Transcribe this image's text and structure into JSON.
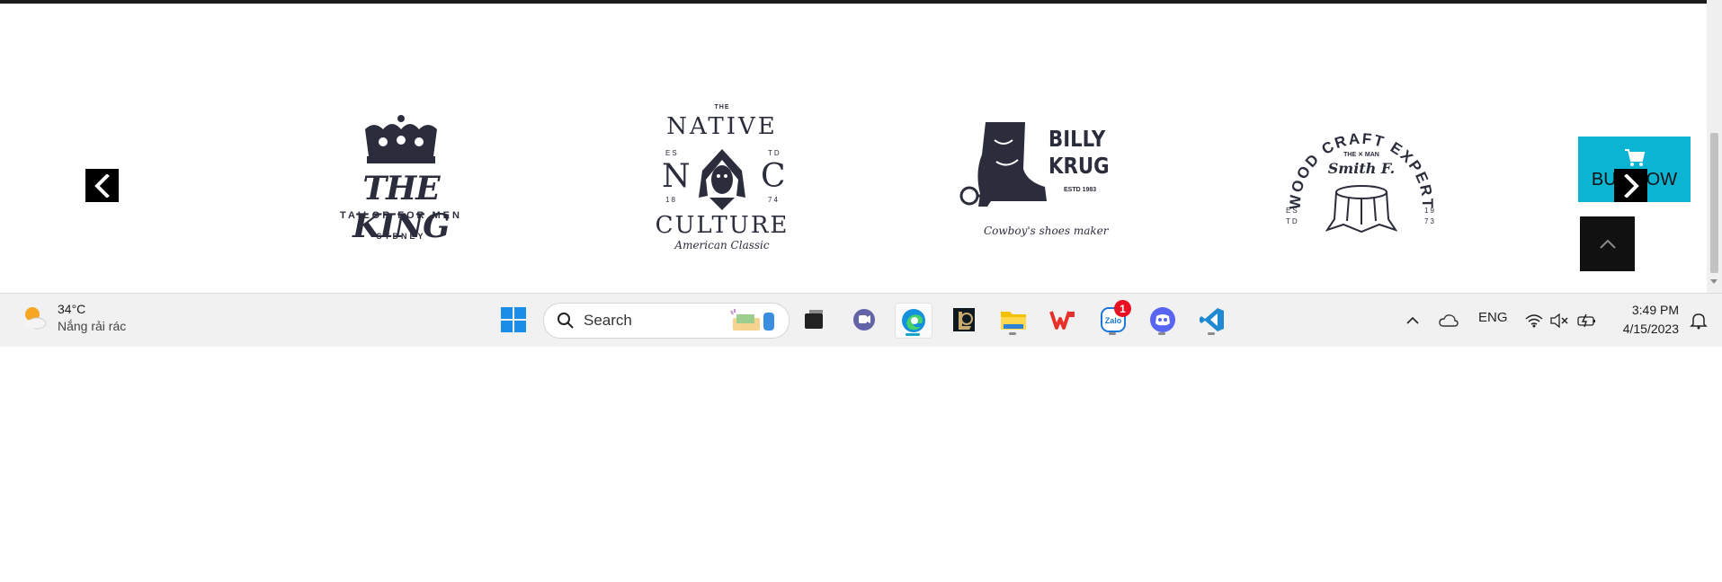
{
  "page": {
    "brands": [
      {
        "name": "THE KING",
        "tagline": "TAILOR FOR MEN",
        "city": "SYDNEY"
      },
      {
        "top": "THE",
        "name_line1": "NATIVE",
        "left_letter": "N",
        "right_letter": "C",
        "name_line2": "CULTURE",
        "script": "American Classic",
        "est_left": "ES",
        "est_right": "TD",
        "year_left": "18",
        "year_right": "74"
      },
      {
        "name_line1": "BILLY",
        "name_line2": "KRUG",
        "estd": "ESTD 1983",
        "script": "Cowboy's shoes maker"
      },
      {
        "arc": "WOOD CRAFT EXPERT",
        "small": "THE ✕ MAN",
        "script": "Smith F.",
        "est_left": "ES",
        "est_left2": "TD",
        "year_left": "19",
        "year_right": "73"
      }
    ],
    "buy_now_label": "BUY NOW",
    "prev_icon": "chevron-left-icon",
    "next_icon": "chevron-right-icon"
  },
  "taskbar": {
    "weather": {
      "temp": "34°C",
      "desc": "Nắng rải rác"
    },
    "search_placeholder": "Search",
    "zalo_badge": "1",
    "zalo_label": "Zalo",
    "lang": "ENG",
    "time": "3:49 PM",
    "date": "4/15/2023"
  },
  "colors": {
    "accent": "#0ab4d2",
    "logo_ink": "#2b2d3c"
  }
}
